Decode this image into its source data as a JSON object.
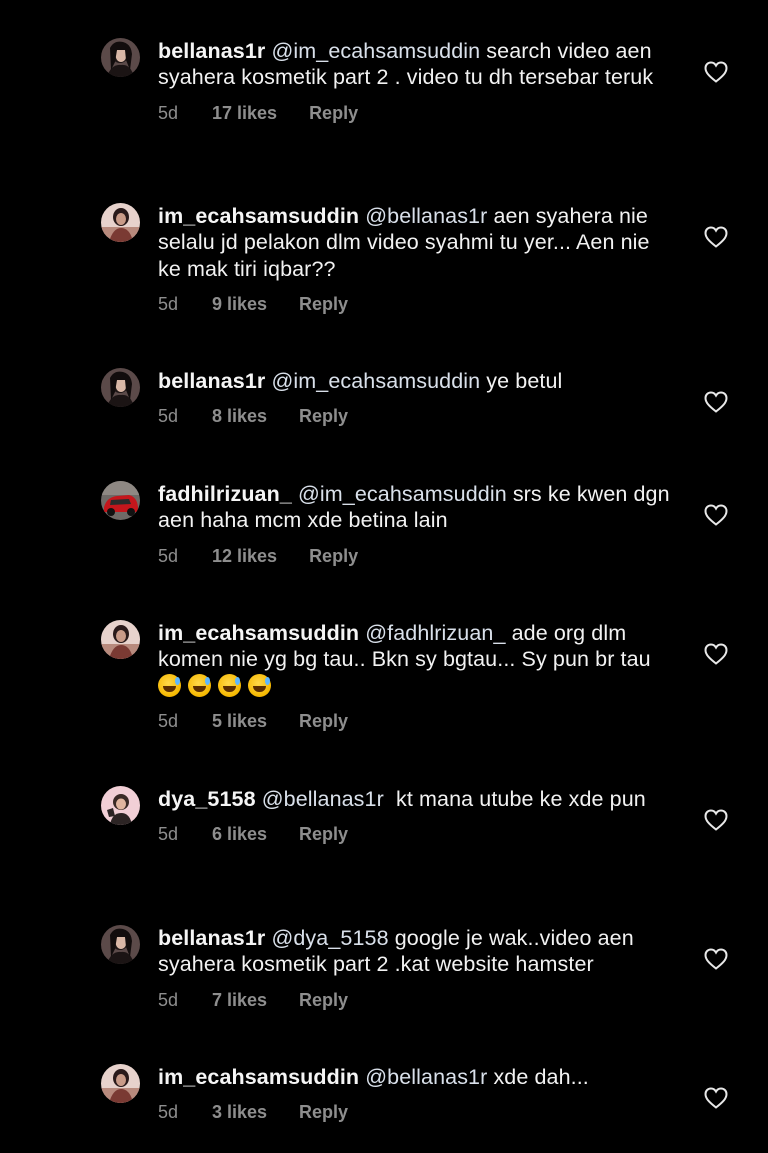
{
  "comments": [
    {
      "username": "bellanas1r",
      "mention": "@im_ecahsamsuddin",
      "text": " search video aen syahera kosmetik part 2 . video tu dh tersebar teruk",
      "time": "5d",
      "likes": "17 likes",
      "reply": "Reply",
      "avatar_icon": "avatar-bellanas1r-icon"
    },
    {
      "username": "im_ecahsamsuddin",
      "mention": "@bellanas1r",
      "text": " aen syahera nie selalu jd pelakon dlm video syahmi tu yer... Aen nie ke mak tiri iqbar??",
      "time": "5d",
      "likes": "9 likes",
      "reply": "Reply",
      "avatar_icon": "avatar-im-ecahsamsuddin-icon"
    },
    {
      "username": "bellanas1r",
      "mention": "@im_ecahsamsuddin",
      "text": " ye betul",
      "time": "5d",
      "likes": "8 likes",
      "reply": "Reply",
      "avatar_icon": "avatar-bellanas1r-icon"
    },
    {
      "username": "fadhilrizuan_",
      "mention": "@im_ecahsamsuddin",
      "text": " srs ke kwen dgn aen haha mcm xde betina lain",
      "time": "5d",
      "likes": "12 likes",
      "reply": "Reply",
      "avatar_icon": "avatar-fadhilrizuan-icon"
    },
    {
      "username": "im_ecahsamsuddin",
      "mention": "@fadhlrizuan_",
      "text": " ade org dlm komen nie yg bg tau.. Bkn sy bgtau... Sy pun br tau ",
      "emoji_count": 4,
      "emoji_name": "grinning-face-with-sweat-emoji",
      "time": "5d",
      "likes": "5 likes",
      "reply": "Reply",
      "avatar_icon": "avatar-im-ecahsamsuddin-icon"
    },
    {
      "username": "dya_5158",
      "mention": "@bellanas1r",
      "text": "  kt mana utube ke xde pun",
      "time": "5d",
      "likes": "6 likes",
      "reply": "Reply",
      "avatar_icon": "avatar-dya-5158-icon"
    },
    {
      "username": "bellanas1r",
      "mention": "@dya_5158",
      "text": " google je wak..video aen syahera kosmetik part 2 .kat website hamster",
      "time": "5d",
      "likes": "7 likes",
      "reply": "Reply",
      "avatar_icon": "avatar-bellanas1r-icon"
    },
    {
      "username": "im_ecahsamsuddin",
      "mention": "@bellanas1r",
      "text": " xde dah...",
      "time": "5d",
      "likes": "3 likes",
      "reply": "Reply",
      "avatar_icon": "avatar-im-ecahsamsuddin-icon"
    }
  ],
  "icons": {
    "like": "heart-outline-icon"
  },
  "colors": {
    "background": "#000000",
    "text": "#f2f2f2",
    "meta": "#8e8e8e"
  }
}
